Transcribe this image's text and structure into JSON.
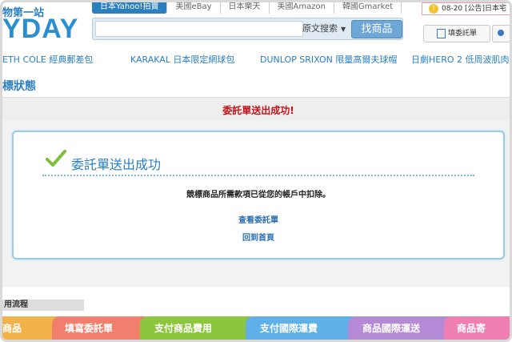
{
  "header": {
    "logo_tagline": "物第一站",
    "logo_text": "YDAY",
    "site_tabs": [
      "日本Yahoo!拍賣",
      "美國eBay",
      "日本樂天",
      "美國Amazon",
      "韓國Gmarket"
    ],
    "search": {
      "value": "",
      "mode": "原文搜索",
      "button": "找商品"
    },
    "notice": {
      "date": "08-20",
      "text": "[公告]日本宅"
    },
    "cart_label": "填委託單"
  },
  "promos": [
    "ETH COLE 經典郵差包",
    "KARAKAL 日本限定網球包",
    "DUNLOP SRIXON 限量高爾夫球帽",
    "日劇HERO 2 低周波肌肉"
  ],
  "page_title": "標狀態",
  "status_message": "委託單送出成功!",
  "result": {
    "title": "委託單送出成功",
    "description": "競標商品所需款項已從您的帳戶中扣除。",
    "links": [
      "查看委託單",
      "回到首頁"
    ]
  },
  "flow": {
    "heading": "用流程",
    "steps": [
      "商品",
      "填寫委託單",
      "支付商品費用",
      "支付國際運費",
      "商品國際運送",
      "商品寄"
    ]
  },
  "colors": {
    "accent": "#2a7fc0",
    "success_red": "#c0141a",
    "box_border": "#9ccbe8"
  }
}
